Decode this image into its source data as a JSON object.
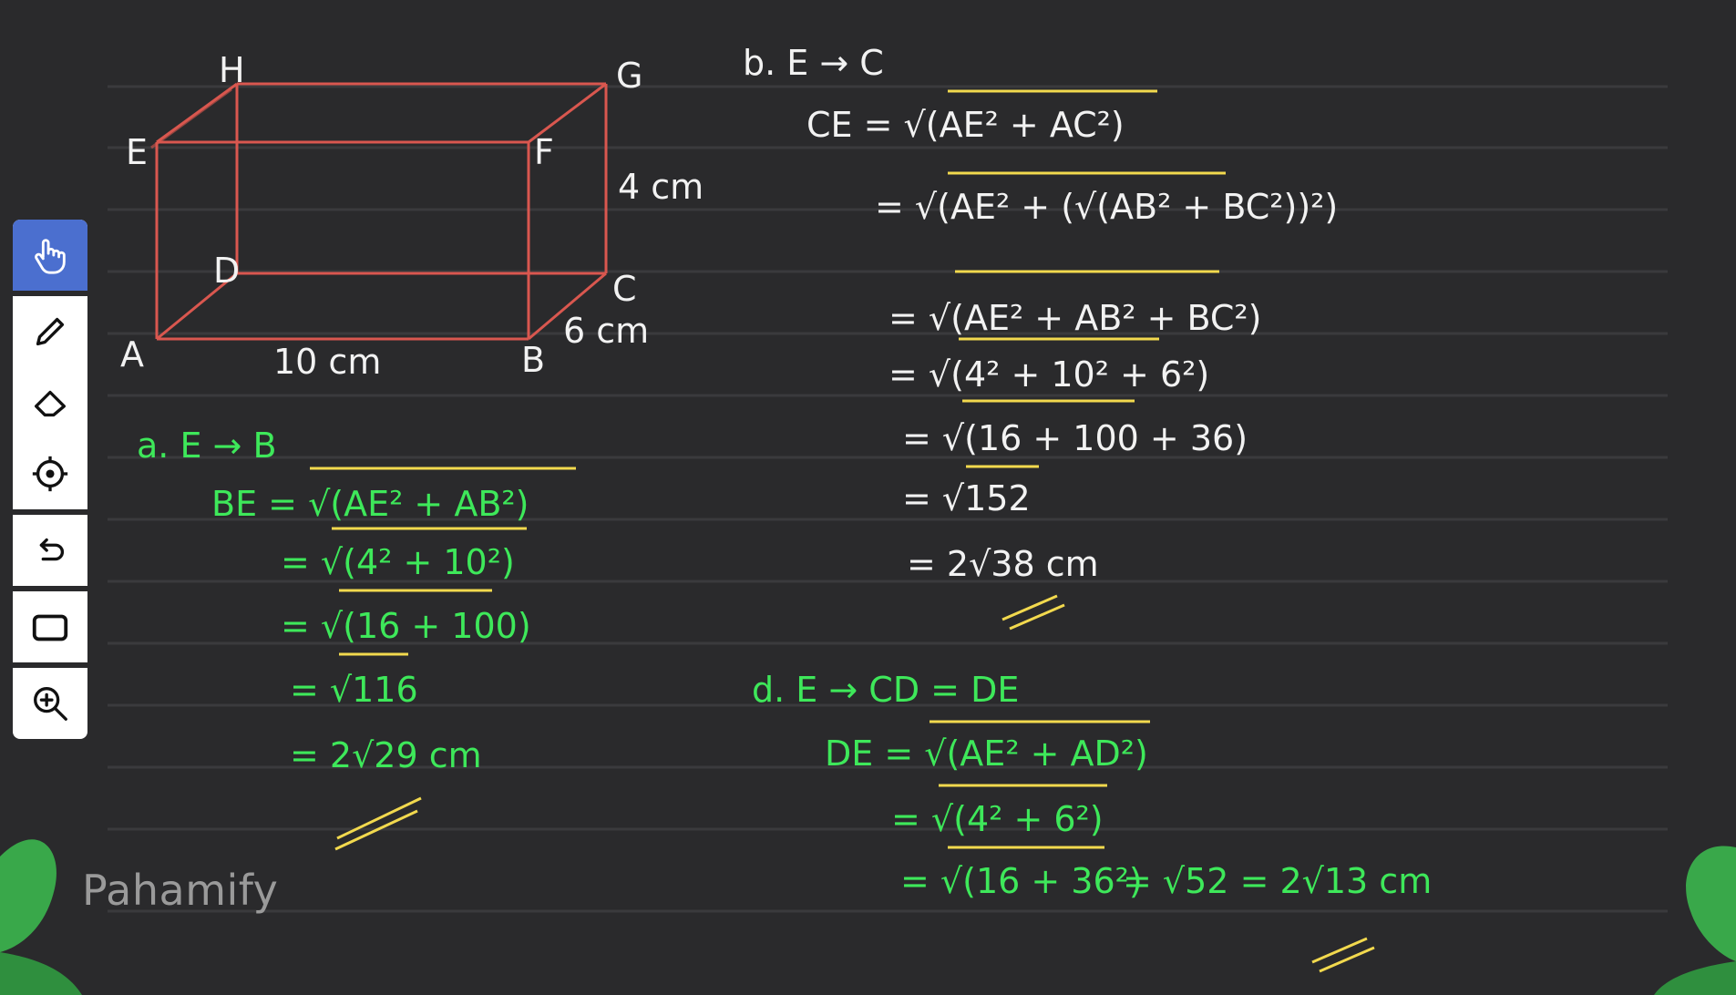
{
  "brand": {
    "name": "Pahamify"
  },
  "toolbar": {
    "tools": [
      {
        "name": "hand-tool",
        "icon": "hand-icon",
        "active": true
      },
      {
        "name": "pen-tool",
        "icon": "pencil-icon",
        "active": false
      },
      {
        "name": "eraser-tool",
        "icon": "eraser-icon",
        "active": false
      },
      {
        "name": "laser-tool",
        "icon": "crosshair-icon",
        "active": false
      },
      {
        "name": "undo-tool",
        "icon": "undo-icon",
        "active": false
      },
      {
        "name": "shape-tool",
        "icon": "rectangle-icon",
        "active": false
      },
      {
        "name": "zoom-tool",
        "icon": "zoom-in-icon",
        "active": false
      }
    ]
  },
  "figure": {
    "vertices": {
      "H": "H",
      "G": "G",
      "E": "E",
      "F": "F",
      "D": "D",
      "C": "C",
      "A": "A",
      "B": "B"
    },
    "dims": {
      "height": "4 cm",
      "depth": "6 cm",
      "length": "10 cm"
    }
  },
  "part_a": {
    "heading": "a.  E → B",
    "lines": [
      "BE = √(AE² + AB²)",
      "= √(4² + 10²)",
      "= √(16 + 100)",
      "= √116",
      "= 2√29  cm"
    ]
  },
  "part_b": {
    "heading": "b.  E → C",
    "lines": [
      "CE = √(AE² + AC²)",
      "= √(AE² + (√(AB² + BC²))²)",
      "= √(AE² + AB² + BC²)",
      "= √(4² + 10² + 6²)",
      "= √(16 + 100 + 36)",
      "= √152",
      "= 2√38  cm"
    ]
  },
  "part_d": {
    "heading": "d.  E → CD = DE",
    "lines": [
      "DE = √(AE² + AD²)",
      "= √(4² + 6²)",
      "= √(16 + 36²)",
      "= √52  = 2√13  cm"
    ]
  },
  "colors": {
    "background": "#2a2a2c",
    "ink_green": "#3ee85a",
    "ink_yellow": "#f2d94e",
    "ink_white": "#f2f2f2",
    "box_red": "#d9574f",
    "toolbar_active": "#4b6fcf",
    "leaf_green": "#39a84a"
  }
}
